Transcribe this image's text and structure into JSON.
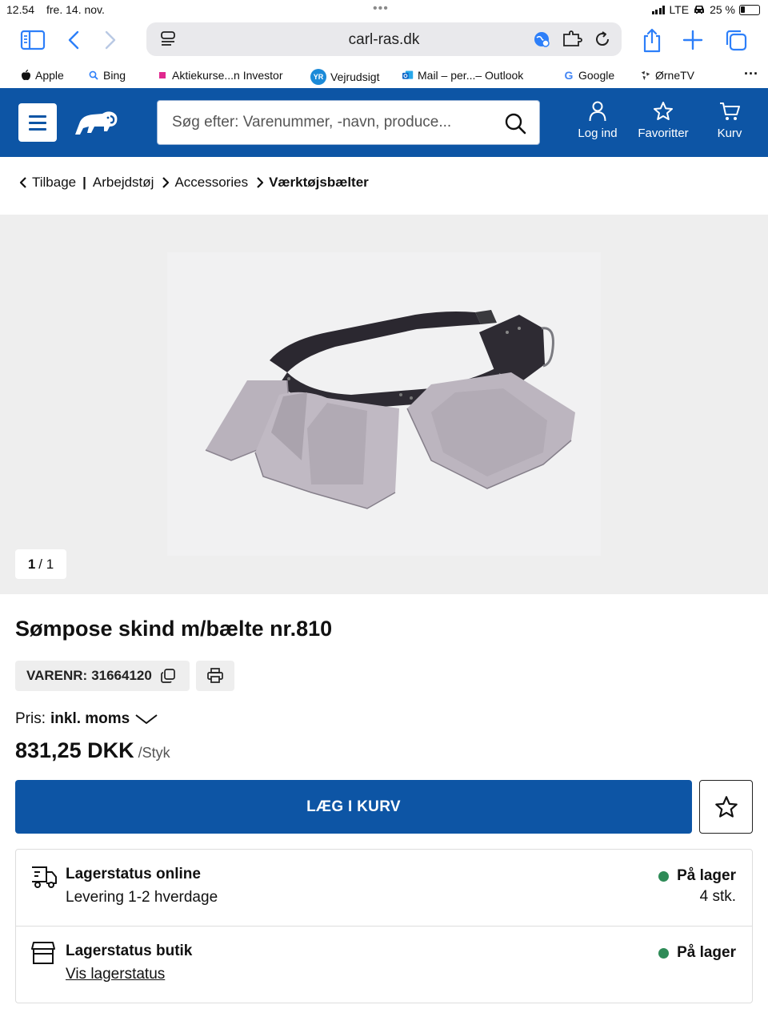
{
  "status_bar": {
    "time": "12.54",
    "date": "fre. 14. nov.",
    "network": "LTE",
    "battery": "25 %"
  },
  "browser": {
    "url": "carl-ras.dk",
    "bookmarks": [
      {
        "label": "Apple"
      },
      {
        "label": "Bing"
      },
      {
        "label": "Aktiekurse...n Investor"
      },
      {
        "label": "Vejrudsigt"
      },
      {
        "label": "Mail – per...– Outlook"
      },
      {
        "label": "Google"
      },
      {
        "label": "ØrneTV"
      }
    ],
    "accent_color": "#2d7ff9"
  },
  "header": {
    "search_placeholder": "Søg efter: Varenummer, -navn, produce...",
    "login_label": "Log ind",
    "favorites_label": "Favoritter",
    "cart_label": "Kurv",
    "brand_color": "#0d55a5"
  },
  "breadcrumb": {
    "back": "Tilbage",
    "items": [
      "Arbejdstøj",
      "Accessories"
    ],
    "current": "Værktøjsbælter"
  },
  "gallery": {
    "current": "1",
    "total": "/ 1"
  },
  "product": {
    "title": "Sømpose skind m/bælte nr.810",
    "sku_label": "VARENR:",
    "sku": "31664120",
    "price_label": "Pris:",
    "price_mode": "inkl. moms",
    "price": "831,25 DKK",
    "unit": "/Styk",
    "add_to_cart": "LÆG I KURV"
  },
  "stock": {
    "online": {
      "title": "Lagerstatus online",
      "subtitle": "Levering 1-2 hverdage",
      "status": "På lager",
      "quantity": "4 stk."
    },
    "store": {
      "title": "Lagerstatus butik",
      "link": "Vis lagerstatus",
      "status": "På lager"
    },
    "in_stock_color": "#2e8b57"
  }
}
